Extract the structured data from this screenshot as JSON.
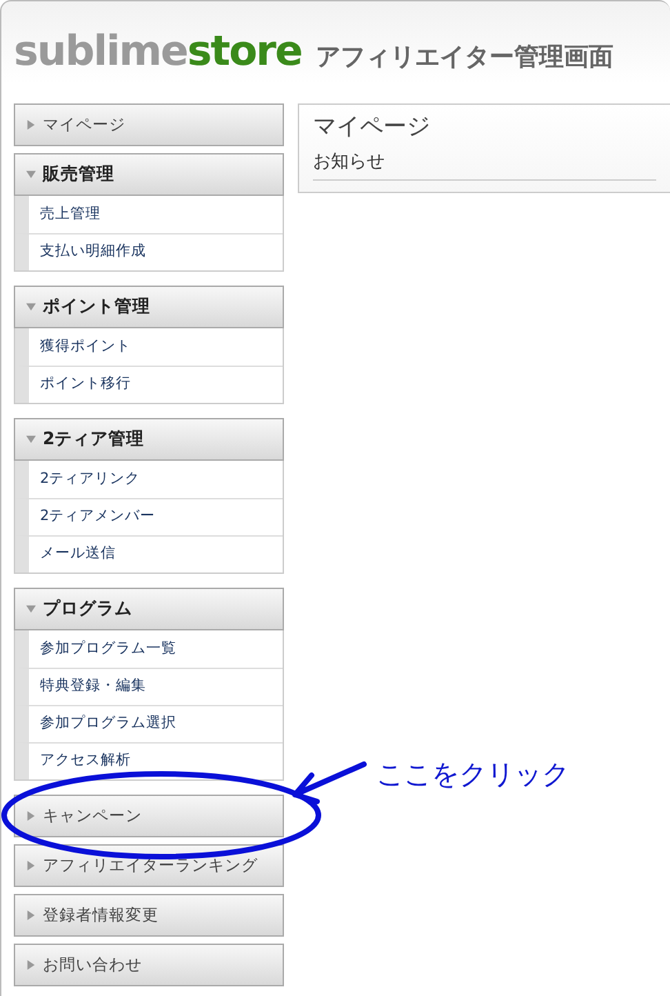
{
  "brand": {
    "gray_part": "sublime",
    "green_part": "store",
    "subtitle": "アフィリエイター管理画面"
  },
  "menu": [
    {
      "label": "マイページ",
      "kind": "link",
      "expanded": false,
      "highlighted": false
    },
    {
      "label": "販売管理",
      "kind": "group",
      "expanded": true,
      "highlighted": false,
      "children": [
        {
          "label": "売上管理"
        },
        {
          "label": "支払い明細作成"
        }
      ]
    },
    {
      "label": "ポイント管理",
      "kind": "group",
      "expanded": true,
      "highlighted": false,
      "children": [
        {
          "label": "獲得ポイント"
        },
        {
          "label": "ポイント移行"
        }
      ]
    },
    {
      "label": "2ティア管理",
      "kind": "group",
      "expanded": true,
      "highlighted": false,
      "children": [
        {
          "label": "2ティアリンク"
        },
        {
          "label": "2ティアメンバー"
        },
        {
          "label": "メール送信"
        }
      ]
    },
    {
      "label": "プログラム",
      "kind": "group",
      "expanded": true,
      "highlighted": false,
      "children": [
        {
          "label": "参加プログラム一覧"
        },
        {
          "label": "特典登録・編集"
        },
        {
          "label": "参加プログラム選択"
        },
        {
          "label": "アクセス解析"
        }
      ]
    },
    {
      "label": "キャンペーン",
      "kind": "link",
      "expanded": false,
      "highlighted": true,
      "callout": "ここをクリック"
    },
    {
      "label": "アフィリエイターランキング",
      "kind": "link",
      "expanded": false,
      "highlighted": false
    },
    {
      "label": "登録者情報変更",
      "kind": "link",
      "expanded": false,
      "highlighted": false
    },
    {
      "label": "お問い合わせ",
      "kind": "link",
      "expanded": false,
      "highlighted": false
    }
  ],
  "main": {
    "title": "マイページ",
    "section": "お知らせ"
  }
}
